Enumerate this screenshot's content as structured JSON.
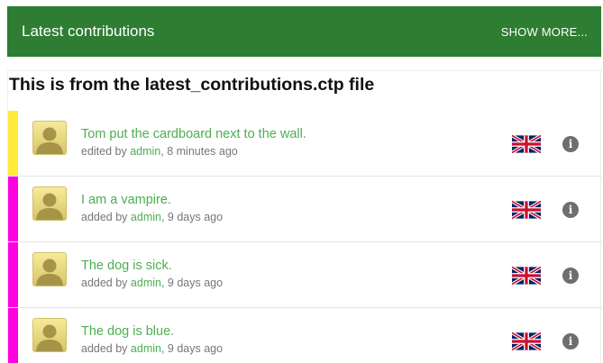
{
  "header": {
    "title": "Latest contributions",
    "show_more": "SHOW MORE...",
    "bg_color": "#2e7d32"
  },
  "card": {
    "heading": "This is from the latest_contributions.ctp file"
  },
  "items": [
    {
      "text": "Tom put the cardboard next to the wall.",
      "action": "edited by",
      "user": "admin",
      "time": ", 8 minutes ago",
      "stripe_color": "#ffeb3b",
      "language_icon": "uk-flag-icon"
    },
    {
      "text": "I am a vampire.",
      "action": "added by",
      "user": "admin",
      "time": ", 9 days ago",
      "stripe_color": "#ff00e0",
      "language_icon": "uk-flag-icon"
    },
    {
      "text": "The dog is sick.",
      "action": "added by",
      "user": "admin",
      "time": ", 9 days ago",
      "stripe_color": "#ff00e0",
      "language_icon": "uk-flag-icon"
    },
    {
      "text": "The dog is blue.",
      "action": "added by",
      "user": "admin",
      "time": ", 9 days ago",
      "stripe_color": "#ff00e0",
      "language_icon": "uk-flag-icon"
    }
  ],
  "colors": {
    "link": "#4caf50",
    "meta": "#777777",
    "info_icon": "#6e6e6e"
  },
  "icons": {
    "avatar": "avatar-icon",
    "info": "info-icon"
  }
}
